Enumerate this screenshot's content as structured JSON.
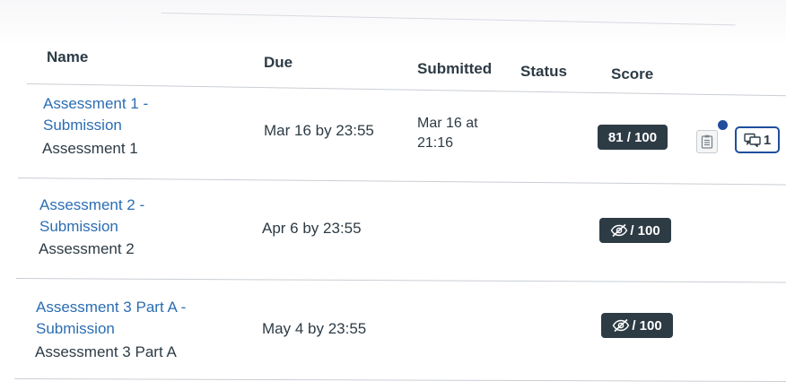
{
  "table": {
    "headers": {
      "name": "Name",
      "due": "Due",
      "submitted": "Submitted",
      "status": "Status",
      "score": "Score"
    },
    "rows": [
      {
        "title_line1": "Assessment 1 -",
        "title_line2": "Submission",
        "group": "Assessment 1",
        "due": "Mar 16 by 23:55",
        "submitted_line1": "Mar 16 at",
        "submitted_line2": "21:16",
        "status": "",
        "score": "81 / 100",
        "score_hidden": false,
        "rubric_icon": "rubric-icon",
        "comment_count": "1"
      },
      {
        "title_line1": "Assessment 2 -",
        "title_line2": "Submission",
        "group": "Assessment 2",
        "due": "Apr 6 by 23:55",
        "submitted_line1": "",
        "submitted_line2": "",
        "status": "",
        "score": "/ 100",
        "score_hidden": true
      },
      {
        "title_line1": "Assessment 3 Part A -",
        "title_line2": "Submission",
        "group": "Assessment 3 Part A",
        "due": "May 4 by 23:55",
        "submitted_line1": "",
        "submitted_line2": "",
        "status": "",
        "score": "/ 100",
        "score_hidden": true
      }
    ]
  },
  "colors": {
    "link": "#2b6db3",
    "text": "#2d3b45",
    "score_pill": "#2d3b45",
    "accent": "#1f4e9c"
  },
  "icons": {
    "hidden_score": "eye-slash-icon",
    "rubric": "rubric-icon",
    "comments": "comments-icon"
  }
}
